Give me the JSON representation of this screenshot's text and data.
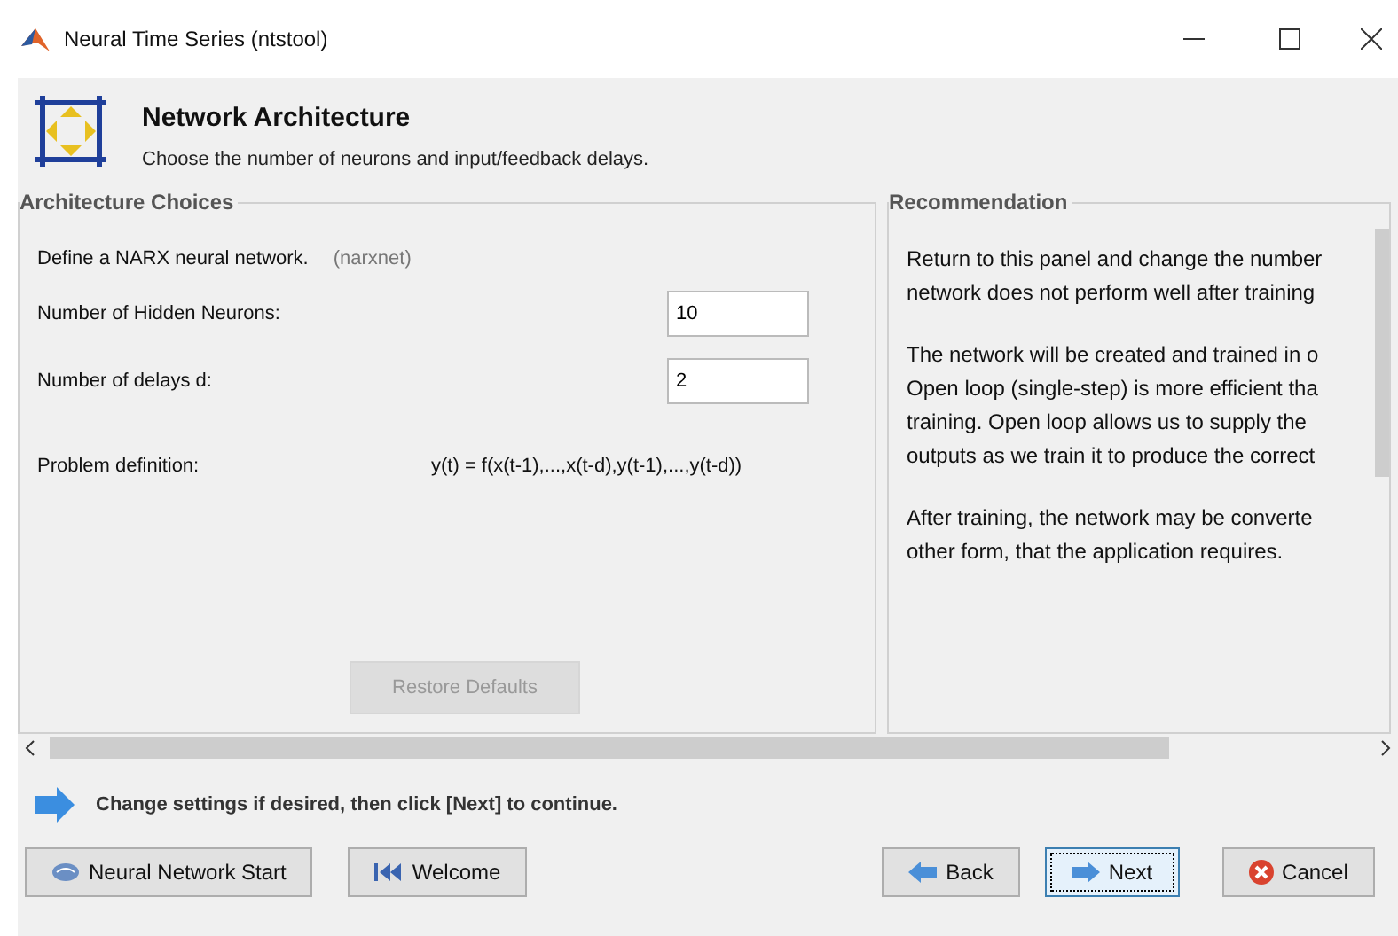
{
  "window": {
    "title": "Neural Time Series (ntstool)"
  },
  "header": {
    "title": "Network Architecture",
    "subtitle": "Choose the number of neurons and input/feedback delays."
  },
  "architecture": {
    "title": "Architecture Choices",
    "define_label": "Define a NARX neural network.",
    "define_note": "(narxnet)",
    "fields": [
      {
        "label": "Number of Hidden Neurons:",
        "value": "10"
      },
      {
        "label": "Number of delays d:",
        "value": "2"
      }
    ],
    "problem_label": "Problem definition:",
    "problem_formula": "y(t) = f(x(t-1),...,x(t-d),y(t-1),...,y(t-d))",
    "restore_button": {
      "label": "Restore Defaults",
      "disabled": true
    }
  },
  "recommendation": {
    "title": "Recommendation",
    "paragraphs": [
      "Return to this panel and change the number\nnetwork does not perform well after training",
      "The network will be created and trained in o\nOpen loop (single-step) is more efficient tha\ntraining. Open loop allows us to supply the\noutputs as we train it to produce the correct",
      "After training, the network may be converte\nother form, that the application requires."
    ]
  },
  "hint": "Change settings  if desired, then click [Next] to continue.",
  "buttons": [
    {
      "label": "Neural Network Start",
      "focused": false
    },
    {
      "label": "Welcome",
      "focused": false
    },
    {
      "label": "Back",
      "focused": false
    },
    {
      "label": "Next",
      "focused": true
    },
    {
      "label": "Cancel",
      "focused": false
    }
  ]
}
